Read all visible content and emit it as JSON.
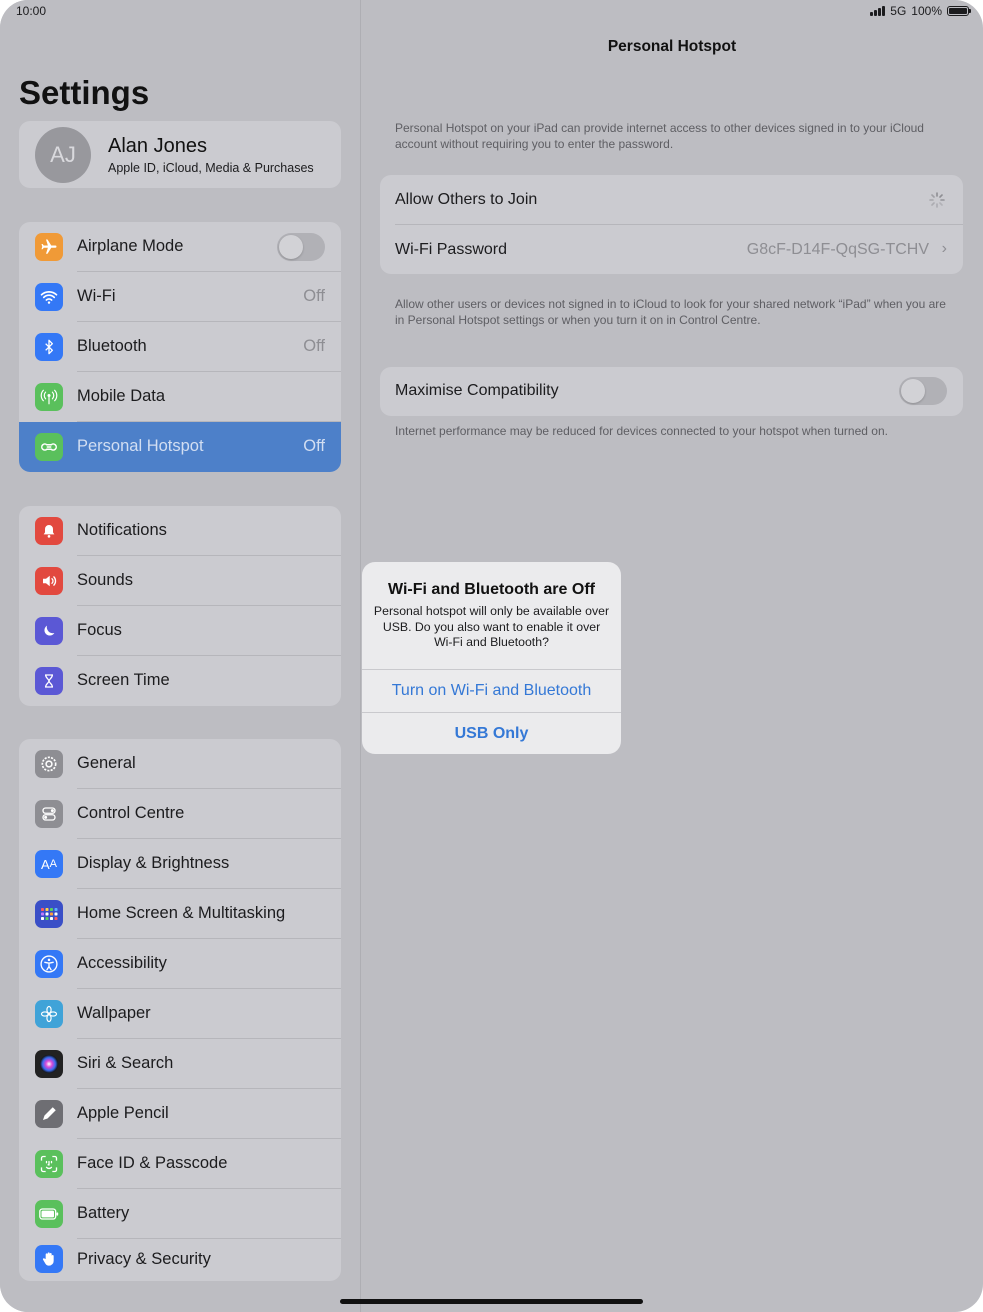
{
  "status_bar": {
    "time": "10:00",
    "network": "5G",
    "battery": "100%"
  },
  "sidebar": {
    "title": "Settings",
    "profile": {
      "initials": "AJ",
      "name": "Alan Jones",
      "subtitle": "Apple ID, iCloud, Media & Purchases"
    },
    "group1": [
      {
        "label": "Airplane Mode",
        "value": "",
        "icon": "airplane-icon",
        "color": "#f09a37"
      },
      {
        "label": "Wi-Fi",
        "value": "Off",
        "icon": "wifi-icon",
        "color": "#3478f6"
      },
      {
        "label": "Bluetooth",
        "value": "Off",
        "icon": "bluetooth-icon",
        "color": "#3478f6"
      },
      {
        "label": "Mobile Data",
        "value": "",
        "icon": "antenna-icon",
        "color": "#5ac05c"
      },
      {
        "label": "Personal Hotspot",
        "value": "Off",
        "icon": "hotspot-icon",
        "color": "#5ac05c"
      }
    ],
    "group2": [
      {
        "label": "Notifications",
        "icon": "bell-icon",
        "color": "#e2493f"
      },
      {
        "label": "Sounds",
        "icon": "speaker-icon",
        "color": "#e2493f"
      },
      {
        "label": "Focus",
        "icon": "moon-icon",
        "color": "#5b58d5"
      },
      {
        "label": "Screen Time",
        "icon": "hourglass-icon",
        "color": "#5b58d5"
      }
    ],
    "group3": [
      {
        "label": "General",
        "icon": "gear-icon",
        "color": "#8e8e93"
      },
      {
        "label": "Control Centre",
        "icon": "switches-icon",
        "color": "#8e8e93"
      },
      {
        "label": "Display & Brightness",
        "icon": "text-size-icon",
        "color": "#3478f6"
      },
      {
        "label": "Home Screen & Multitasking",
        "icon": "grid-icon",
        "color": "#3a4fc7"
      },
      {
        "label": "Accessibility",
        "icon": "accessibility-icon",
        "color": "#3478f6"
      },
      {
        "label": "Wallpaper",
        "icon": "flower-icon",
        "color": "#40a3d8"
      },
      {
        "label": "Siri & Search",
        "icon": "siri-icon",
        "color": "#222222"
      },
      {
        "label": "Apple Pencil",
        "icon": "pencil-icon",
        "color": "#6e6e73"
      },
      {
        "label": "Face ID & Passcode",
        "icon": "face-id-icon",
        "color": "#5ac05c"
      },
      {
        "label": "Battery",
        "icon": "battery-icon",
        "color": "#5ac05c"
      },
      {
        "label": "Privacy & Security",
        "icon": "hand-icon",
        "color": "#3478f6"
      }
    ]
  },
  "detail": {
    "title": "Personal Hotspot",
    "intro": "Personal Hotspot on your iPad can provide internet access to other devices signed in to your iCloud account without requiring you to enter the password.",
    "allow_label": "Allow Others to Join",
    "wifi_password_label": "Wi-Fi Password",
    "wifi_password_value": "G8cF-D14F-QqSG-TCHV",
    "allow_footer": "Allow other users or devices not signed in to iCloud to look for your shared network “iPad” when you are in Personal Hotspot settings or when you turn it on in Control Centre.",
    "compat_label": "Maximise Compatibility",
    "compat_footer": "Internet performance may be reduced for devices connected to your hotspot when turned on."
  },
  "alert": {
    "title": "Wi-Fi and Bluetooth are Off",
    "message": "Personal hotspot will only be available over USB. Do you also want to enable it over Wi-Fi and Bluetooth?",
    "primary": "Turn on Wi-Fi and Bluetooth",
    "secondary": "USB Only"
  }
}
